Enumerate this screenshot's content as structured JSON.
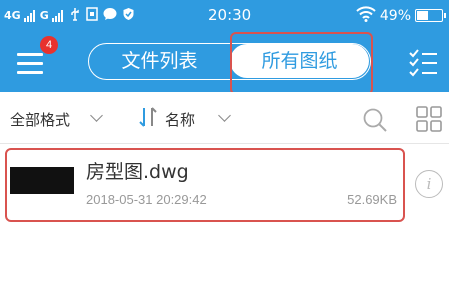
{
  "status_bar": {
    "network_1": "4G",
    "network_2": "G",
    "time": "20:30",
    "battery_percent": "49%",
    "battery_level": 0.49,
    "icons": [
      "signal-icon",
      "usb-icon",
      "sim-icon",
      "chat-bubble-icon",
      "shield-icon",
      "wifi-icon",
      "battery-icon"
    ]
  },
  "header": {
    "menu_badge": "4",
    "tabs": [
      {
        "label": "文件列表",
        "selected": false
      },
      {
        "label": "所有图纸",
        "selected": true
      }
    ],
    "accent_color": "#2f9be0",
    "highlight_color": "#d9534f"
  },
  "filter_bar": {
    "format_label": "全部格式",
    "sort_label": "名称"
  },
  "files": [
    {
      "name": "房型图.dwg",
      "modified": "2018-05-31 20:29:42",
      "size": "52.69KB"
    }
  ]
}
